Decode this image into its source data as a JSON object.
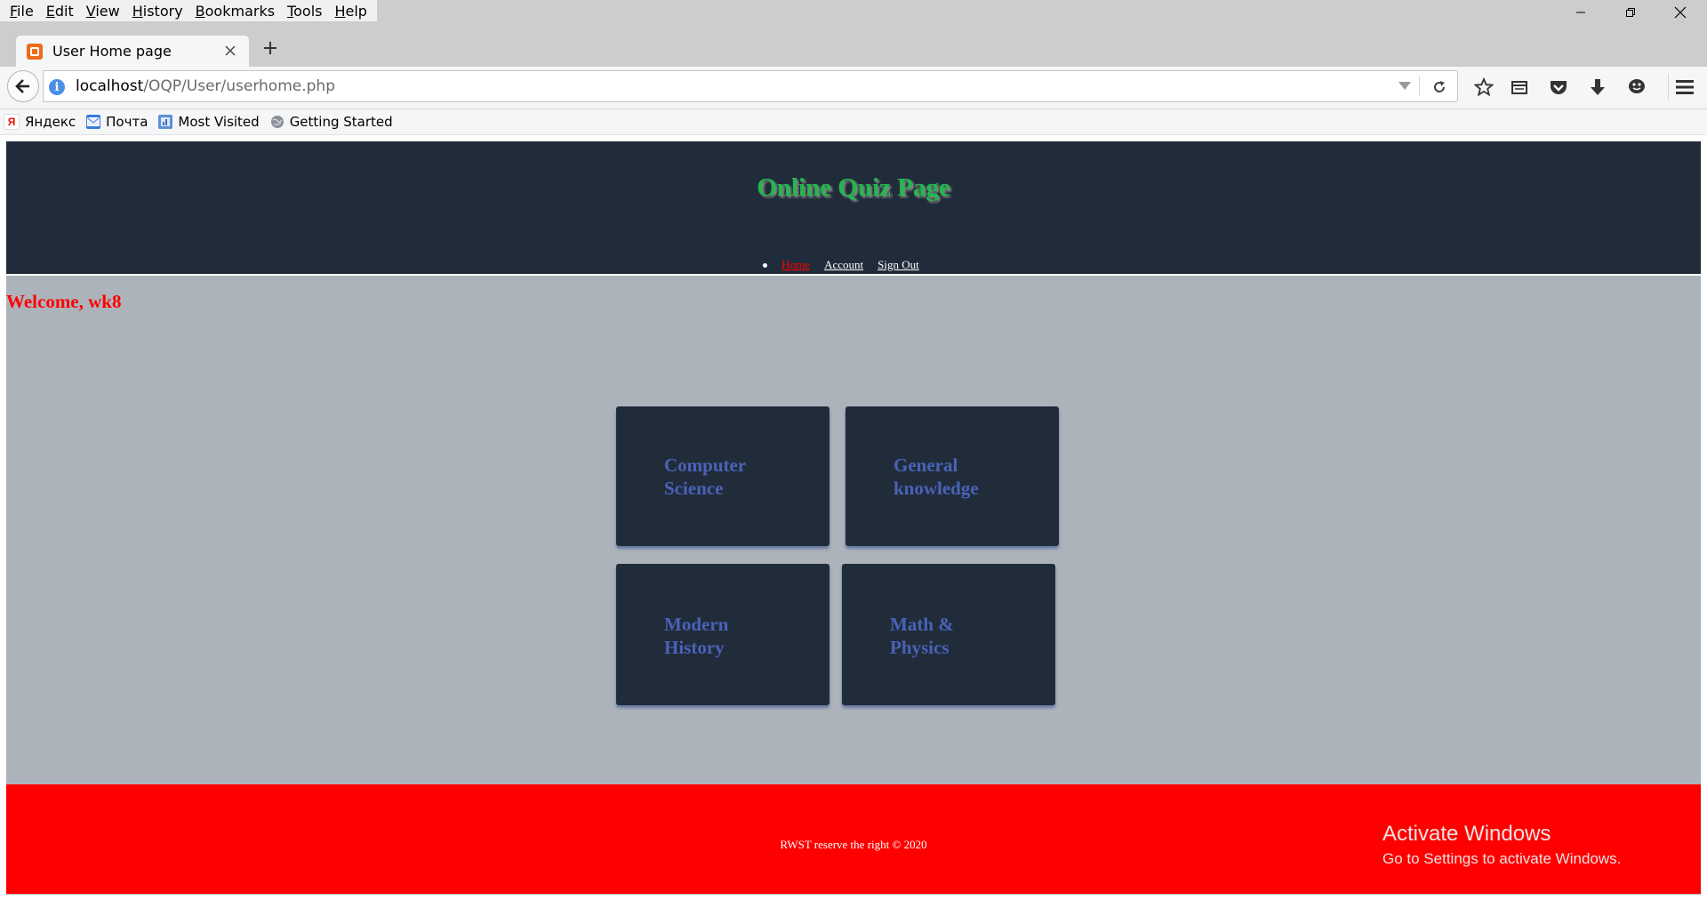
{
  "menubar": {
    "items": [
      {
        "label": "File",
        "key": "F",
        "rest": "ile"
      },
      {
        "label": "Edit",
        "key": "E",
        "rest": "dit"
      },
      {
        "label": "View",
        "key": "V",
        "rest": "iew"
      },
      {
        "label": "History",
        "key": "H",
        "rest": "istory"
      },
      {
        "label": "Bookmarks",
        "key": "B",
        "rest": "ookmarks"
      },
      {
        "label": "Tools",
        "key": "T",
        "rest": "ools"
      },
      {
        "label": "Help",
        "key": "H",
        "rest": "elp"
      }
    ]
  },
  "tab": {
    "title": "User Home page"
  },
  "urlbar": {
    "host": "localhost",
    "path": "/OQP/User/userhome.php"
  },
  "bookmarks": [
    {
      "label": "Яндекс",
      "icon": "yandex-icon"
    },
    {
      "label": "Почта",
      "icon": "mail-icon"
    },
    {
      "label": "Most Visited",
      "icon": "most-visited-icon"
    },
    {
      "label": "Getting Started",
      "icon": "globe-icon"
    }
  ],
  "site": {
    "title": "Online Quiz Page",
    "nav": [
      {
        "label": "Home",
        "active": true
      },
      {
        "label": "Account",
        "active": false
      },
      {
        "label": "Sign Out",
        "active": false
      }
    ],
    "welcome": "Welcome, wk8",
    "categories": [
      {
        "line1": "Computer",
        "line2": "Science"
      },
      {
        "line1": "General",
        "line2": "knowledge"
      },
      {
        "line1": "Modern",
        "line2": "History"
      },
      {
        "line1": "Math &",
        "line2": "Physics"
      }
    ],
    "footer": "RWST reserve the right © 2020"
  },
  "watermark": {
    "title": "Activate Windows",
    "subtitle": "Go to Settings to activate Windows."
  },
  "colors": {
    "header_bg": "#212c3b",
    "title_green": "#22b84c",
    "welcome_red": "#ff0000",
    "footer_red": "#ff0000",
    "content_bg": "#adb3bb",
    "card_text": "#4a62b8"
  }
}
